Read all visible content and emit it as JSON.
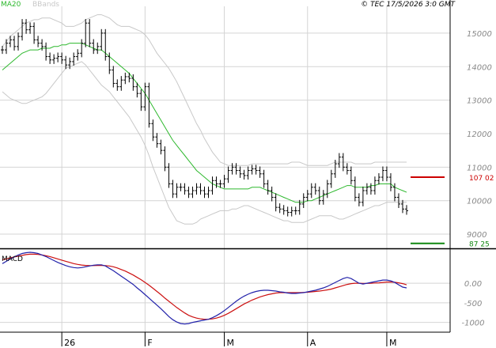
{
  "header": {
    "legend_ma": "MA20",
    "legend_bb": "BBands",
    "timestamp": "© TEC 17/5/2026 3:0 GMT"
  },
  "colors": {
    "price": "#000000",
    "ma": "#2db82d",
    "bbands": "#c8c8c8",
    "macd": "#2222aa",
    "signal": "#cc1111",
    "grid": "#d4d4d4",
    "axis_text": "#888888",
    "resistance": "#cc0000",
    "support": "#118811"
  },
  "chart_data": [
    {
      "type": "line",
      "panel": "price",
      "title": "",
      "ylim": [
        8600,
        15800
      ],
      "y_ticks": [
        {
          "value": 15000,
          "label": "15000"
        },
        {
          "value": 14000,
          "label": "14000"
        },
        {
          "value": 13000,
          "label": "13000"
        },
        {
          "value": 12000,
          "label": "12000"
        },
        {
          "value": 11000,
          "label": "11000"
        },
        {
          "value": 10000,
          "label": "10000"
        },
        {
          "value": 9000,
          "label": "9000"
        }
      ],
      "x_ticks": [
        {
          "index": 15,
          "label": "26"
        },
        {
          "index": 36,
          "label": "F"
        },
        {
          "index": 56,
          "label": "M"
        },
        {
          "index": 77,
          "label": "A"
        },
        {
          "index": 97,
          "label": "M"
        }
      ],
      "series": [
        {
          "name": "",
          "role": "price",
          "values": [
            14500,
            14700,
            14800,
            14600,
            14900,
            15300,
            15100,
            15200,
            14800,
            14700,
            14600,
            14300,
            14200,
            14250,
            14300,
            14200,
            14050,
            14150,
            14300,
            14400,
            14700,
            15300,
            14700,
            14500,
            14600,
            15000,
            14300,
            13900,
            13500,
            13400,
            13600,
            13700,
            13650,
            13400,
            13200,
            12800,
            13400,
            12300,
            11900,
            11700,
            11500,
            11000,
            10500,
            10200,
            10400,
            10400,
            10300,
            10200,
            10300,
            10400,
            10300,
            10200,
            10300,
            10600,
            10500,
            10500,
            10650,
            10900,
            11000,
            10900,
            10800,
            10750,
            10900,
            10950,
            10900,
            10800,
            10500,
            10300,
            10100,
            9800,
            9750,
            9700,
            9650,
            9700,
            9700,
            9900,
            10100,
            10200,
            10400,
            10300,
            10000,
            10200,
            10500,
            10800,
            11100,
            11300,
            11000,
            10900,
            10600,
            10100,
            9950,
            10300,
            10400,
            10300,
            10600,
            10700,
            10900,
            10700,
            10400,
            10100,
            9900,
            9750,
            9700
          ]
        },
        {
          "name": "MA20",
          "role": "ma",
          "values": [
            13900,
            14000,
            14100,
            14200,
            14300,
            14400,
            14450,
            14500,
            14500,
            14500,
            14550,
            14550,
            14550,
            14600,
            14600,
            14650,
            14650,
            14700,
            14700,
            14700,
            14700,
            14650,
            14600,
            14550,
            14500,
            14500,
            14400,
            14300,
            14200,
            14100,
            14000,
            13900,
            13800,
            13650,
            13500,
            13350,
            13200,
            13000,
            12800,
            12600,
            12400,
            12200,
            12000,
            11800,
            11650,
            11500,
            11350,
            11200,
            11050,
            10900,
            10800,
            10700,
            10600,
            10500,
            10450,
            10400,
            10350,
            10350,
            10350,
            10350,
            10350,
            10350,
            10350,
            10400,
            10400,
            10400,
            10350,
            10300,
            10250,
            10200,
            10150,
            10100,
            10050,
            10000,
            9950,
            9950,
            9950,
            10000,
            10000,
            10050,
            10100,
            10150,
            10200,
            10250,
            10300,
            10350,
            10400,
            10450,
            10450,
            10400,
            10400,
            10400,
            10400,
            10450,
            10450,
            10500,
            10500,
            10500,
            10500,
            10400,
            10350,
            10300,
            10250
          ]
        },
        {
          "name": "BBands",
          "role": "bb_upper",
          "values": [
            14600,
            14750,
            14900,
            15000,
            15100,
            15200,
            15300,
            15350,
            15400,
            15400,
            15450,
            15450,
            15450,
            15400,
            15350,
            15300,
            15200,
            15200,
            15200,
            15250,
            15300,
            15400,
            15450,
            15500,
            15550,
            15550,
            15500,
            15450,
            15350,
            15250,
            15200,
            15200,
            15200,
            15150,
            15100,
            15050,
            14950,
            14800,
            14600,
            14400,
            14250,
            14100,
            13950,
            13750,
            13550,
            13300,
            13050,
            12800,
            12550,
            12300,
            12100,
            11850,
            11650,
            11450,
            11300,
            11150,
            11100,
            11050,
            11050,
            11050,
            11050,
            11050,
            11050,
            11100,
            11100,
            11100,
            11100,
            11100,
            11100,
            11100,
            11100,
            11100,
            11100,
            11150,
            11150,
            11150,
            11100,
            11050,
            11050,
            11050,
            11050,
            11050,
            11050,
            11100,
            11150,
            11150,
            11150,
            11150,
            11150,
            11100,
            11100,
            11100,
            11100,
            11100,
            11150,
            11150,
            11150,
            11150,
            11150,
            11150,
            11150,
            11150,
            11150
          ]
        },
        {
          "name": "BBands",
          "role": "bb_lower",
          "values": [
            13250,
            13150,
            13050,
            13000,
            12950,
            12900,
            12900,
            12950,
            13000,
            13050,
            13100,
            13200,
            13350,
            13500,
            13650,
            13800,
            13950,
            14000,
            14050,
            14100,
            14150,
            14050,
            13900,
            13750,
            13600,
            13450,
            13350,
            13250,
            13100,
            12950,
            12800,
            12650,
            12500,
            12300,
            12100,
            11900,
            11650,
            11350,
            11000,
            10700,
            10400,
            10100,
            9800,
            9600,
            9400,
            9350,
            9300,
            9300,
            9300,
            9350,
            9450,
            9500,
            9550,
            9600,
            9650,
            9700,
            9700,
            9700,
            9750,
            9750,
            9800,
            9850,
            9850,
            9800,
            9750,
            9700,
            9650,
            9600,
            9550,
            9500,
            9450,
            9400,
            9400,
            9350,
            9350,
            9350,
            9350,
            9400,
            9450,
            9500,
            9550,
            9550,
            9550,
            9550,
            9500,
            9450,
            9450,
            9500,
            9550,
            9600,
            9650,
            9700,
            9750,
            9800,
            9850,
            9850,
            9900,
            9950,
            9950,
            9950,
            9950,
            9950,
            9950
          ]
        }
      ],
      "levels": [
        {
          "role": "resistance",
          "value": 10702,
          "label": "107 02"
        },
        {
          "role": "support",
          "value": 8725,
          "label": "87 25"
        }
      ]
    },
    {
      "type": "line",
      "panel": "macd",
      "title": "MACD",
      "ylim": [
        -1250,
        850
      ],
      "y_ticks": [
        {
          "value": 0,
          "label": "0.00"
        },
        {
          "value": -500,
          "label": "-500"
        },
        {
          "value": -1000,
          "label": "-1000"
        }
      ],
      "series": [
        {
          "name": "",
          "role": "macd",
          "values": [
            500,
            560,
            620,
            670,
            720,
            760,
            780,
            790,
            780,
            760,
            720,
            680,
            630,
            580,
            530,
            490,
            450,
            420,
            400,
            390,
            400,
            420,
            440,
            460,
            470,
            470,
            440,
            380,
            320,
            250,
            180,
            110,
            40,
            -30,
            -120,
            -200,
            -290,
            -380,
            -470,
            -560,
            -650,
            -750,
            -850,
            -930,
            -990,
            -1030,
            -1040,
            -1030,
            -1000,
            -980,
            -960,
            -940,
            -920,
            -880,
            -830,
            -770,
            -700,
            -620,
            -540,
            -460,
            -390,
            -330,
            -280,
            -240,
            -210,
            -190,
            -180,
            -180,
            -190,
            -200,
            -220,
            -230,
            -250,
            -260,
            -260,
            -250,
            -240,
            -220,
            -200,
            -180,
            -150,
            -120,
            -80,
            -30,
            20,
            70,
            120,
            150,
            120,
            60,
            0,
            -20,
            0,
            20,
            40,
            60,
            80,
            80,
            60,
            20,
            -40,
            -100,
            -120
          ]
        },
        {
          "name": "",
          "role": "signal",
          "values": [
            600,
            620,
            650,
            670,
            690,
            710,
            730,
            740,
            740,
            735,
            720,
            700,
            680,
            650,
            620,
            590,
            560,
            530,
            500,
            480,
            465,
            455,
            450,
            450,
            455,
            455,
            450,
            440,
            420,
            390,
            350,
            310,
            260,
            210,
            150,
            90,
            20,
            -50,
            -130,
            -210,
            -290,
            -380,
            -460,
            -540,
            -620,
            -690,
            -760,
            -820,
            -860,
            -890,
            -910,
            -920,
            -920,
            -910,
            -890,
            -860,
            -820,
            -770,
            -710,
            -650,
            -590,
            -530,
            -480,
            -430,
            -390,
            -350,
            -320,
            -290,
            -270,
            -250,
            -240,
            -240,
            -240,
            -240,
            -240,
            -240,
            -235,
            -230,
            -220,
            -210,
            -200,
            -185,
            -170,
            -150,
            -120,
            -90,
            -60,
            -30,
            -10,
            0,
            0,
            -5,
            -5,
            0,
            5,
            10,
            20,
            30,
            30,
            25,
            10,
            -10,
            -40
          ]
        }
      ]
    }
  ]
}
